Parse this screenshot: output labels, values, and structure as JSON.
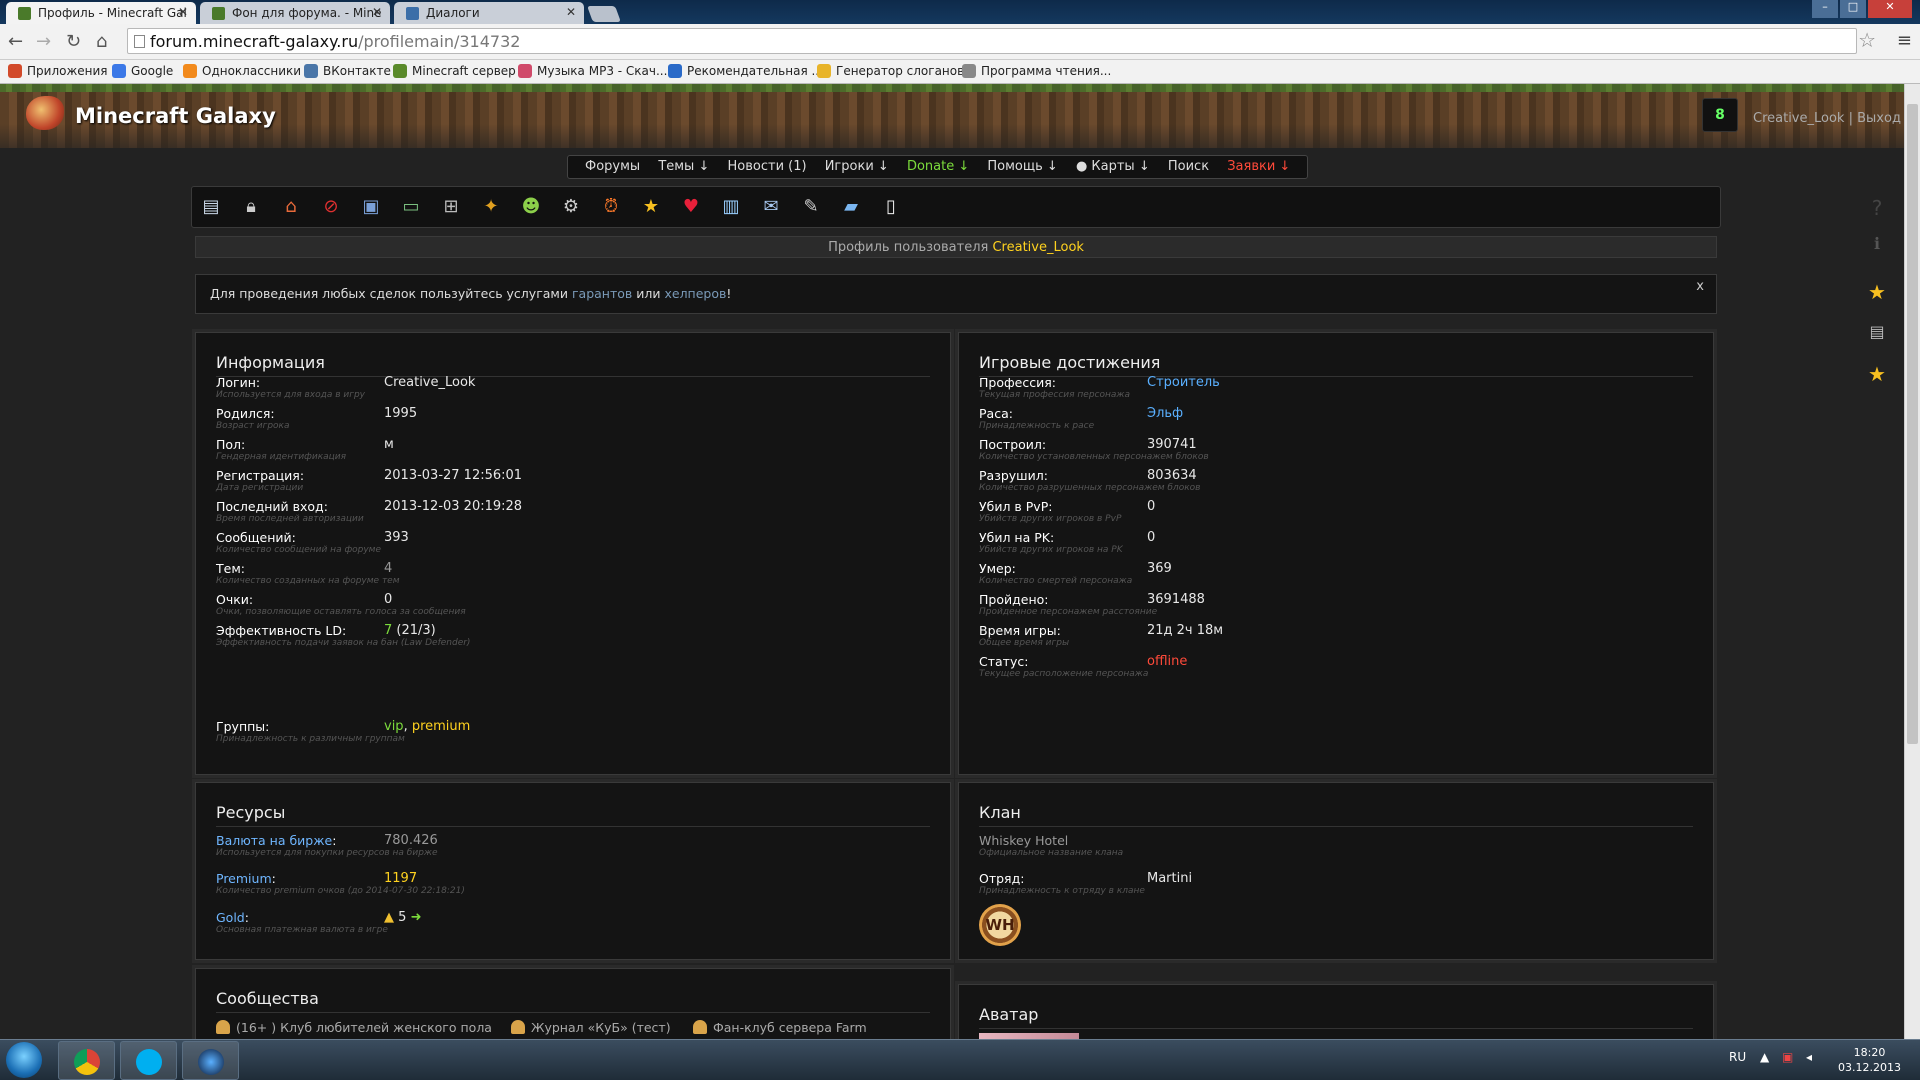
{
  "browser": {
    "tabs": [
      {
        "label": "Профиль - Minecraft Gal",
        "favcolor": "#4a7a2a"
      },
      {
        "label": "Фон для форума. - Mine",
        "favcolor": "#4a7a2a"
      },
      {
        "label": "Диалоги",
        "favcolor": "#3b6ea8"
      }
    ],
    "url_host": "forum.minecraft-galaxy.ru",
    "url_path": "/profilemain/314732",
    "bookmarks": [
      {
        "label": "Приложения",
        "color": "#d24a2a"
      },
      {
        "label": "Google",
        "color": "#3b78e7"
      },
      {
        "label": "Одноклассники",
        "color": "#f28a1c"
      },
      {
        "label": "ВКонтакте",
        "color": "#4a76a8"
      },
      {
        "label": "Minecraft сервер",
        "color": "#5a8a2a"
      },
      {
        "label": "Музыка MP3 - Скач...",
        "color": "#d04a6a"
      },
      {
        "label": "Рекомендательная ...",
        "color": "#2a6ac8"
      },
      {
        "label": "Генератор слоганов",
        "color": "#e8b42a"
      },
      {
        "label": "Программа чтения...",
        "color": "#888888"
      }
    ]
  },
  "site": {
    "title": "Minecraft Galaxy",
    "notif_count": "8",
    "username": "Creative_Look",
    "logout": "Выход",
    "menu": [
      {
        "label": "Форумы",
        "color": "#dddddd"
      },
      {
        "label": "Темы ↓",
        "color": "#dddddd"
      },
      {
        "label": "Новости (1)",
        "color": "#dddddd"
      },
      {
        "label": "Игроки ↓",
        "color": "#dddddd"
      },
      {
        "label": "Donate ↓",
        "color": "#7cdc3c"
      },
      {
        "label": "Помощь ↓",
        "color": "#dddddd"
      },
      {
        "label": "● Карты ↓",
        "color": "#dddddd"
      },
      {
        "label": "Поиск",
        "color": "#dddddd"
      },
      {
        "label": "Заявки ↓",
        "color": "#ff4a3a"
      }
    ],
    "icons": [
      "profile-card-icon",
      "lock-icon",
      "home-icon",
      "ban-icon",
      "gallery-icon",
      "monitor-icon",
      "cart-icon",
      "medal-icon",
      "user-icon",
      "gear-icon",
      "alarm-icon",
      "star-icon",
      "heart-icon",
      "chart-icon",
      "mail-icon",
      "edit-icon",
      "folder-icon",
      "notepad-icon"
    ],
    "profile_bar_prefix": "Профиль пользователя",
    "profile_bar_name": "Creative_Look",
    "alert": {
      "text1": "Для проведения любых сделок пользуйтесь услугами",
      "link1": "гарантов",
      "text2": "или",
      "link2": "хелперов",
      "text3": "!",
      "close": "x"
    },
    "info": {
      "title": "Информация",
      "rows": [
        {
          "label": "Логин:",
          "sub": "Используется для входа в игру",
          "value": "Creative_Look",
          "cls": ""
        },
        {
          "label": "Родился:",
          "sub": "Возраст игрока",
          "value": "1995",
          "cls": ""
        },
        {
          "label": "Пол:",
          "sub": "Гендерная идентификация",
          "value": "м",
          "cls": ""
        },
        {
          "label": "Регистрация:",
          "sub": "Дата регистрации",
          "value": "2013-03-27 12:56:01",
          "cls": ""
        },
        {
          "label": "Последний вход:",
          "sub": "Время последней авторизации",
          "value": "2013-12-03 20:19:28",
          "cls": ""
        },
        {
          "label": "Сообщений:",
          "sub": "Количество сообщений на форуме",
          "value": "393",
          "cls": ""
        },
        {
          "label": "Тем:",
          "sub": "Количество созданных на форуме тем",
          "value": "4",
          "cls": "gray"
        },
        {
          "label": "Очки:",
          "sub": "Очки, позволяющие оставлять голоса за сообщения",
          "value": "0",
          "cls": ""
        },
        {
          "label": "Эффективность LD:",
          "sub": "Эффективность подачи заявок на бан (Law Defender)",
          "value": "7",
          "value_extra": " (21/3)",
          "cls": "green"
        }
      ],
      "groups_label": "Группы:",
      "groups_sub": "Принадлежность к различным группам",
      "group1": "vip",
      "group_sep": ", ",
      "group2": "premium"
    },
    "achievements": {
      "title": "Игровые достижения",
      "rows": [
        {
          "label": "Профессия:",
          "sub": "Текущая профессия персонажа",
          "value": "Строитель",
          "cls": "blue"
        },
        {
          "label": "Раса:",
          "sub": "Принадлежность к расе",
          "value": "Эльф",
          "cls": "blue"
        },
        {
          "label": "Построил:",
          "sub": "Количество установленных персонажем блоков",
          "value": "390741",
          "cls": ""
        },
        {
          "label": "Разрушил:",
          "sub": "Количество разрушенных персонажем блоков",
          "value": "803634",
          "cls": ""
        },
        {
          "label": "Убил в PvP:",
          "sub": "Убийств других игроков в PvP",
          "value": "0",
          "cls": ""
        },
        {
          "label": "Убил на PK:",
          "sub": "Убийств других игроков на PK",
          "value": "0",
          "cls": ""
        },
        {
          "label": "Умер:",
          "sub": "Количество смертей персонажа",
          "value": "369",
          "cls": ""
        },
        {
          "label": "Пройдено:",
          "sub": "Пройденное персонажем расстояние",
          "value": "3691488",
          "cls": ""
        },
        {
          "label": "Время игры:",
          "sub": "Общее время игры",
          "value": "21д 2ч 18м",
          "cls": ""
        },
        {
          "label": "Статус:",
          "sub": "Текущее расположение персонажа",
          "value": "offline",
          "cls": "red"
        }
      ]
    },
    "resources": {
      "title": "Ресурсы",
      "rows": [
        {
          "label": "Валюта на бирже",
          "sub": "Используется для покупки ресурсов на бирже",
          "value": "780.426",
          "cls": "gray"
        },
        {
          "label": "Premium",
          "sub": "Количество premium очков (до 2014-07-30 22:18:21)",
          "value": "1197",
          "cls": "yellow"
        },
        {
          "label": "Gold",
          "sub": "Основная платежная валюта в игре",
          "value": "5",
          "cls": ""
        }
      ],
      "colon": ":"
    },
    "clan": {
      "title": "Клан",
      "name": "Whiskey Hotel",
      "name_sub": "Официальное название клана",
      "squad_label": "Отряд:",
      "squad_sub": "Принадлежность к отряду в клане",
      "squad": "Martini",
      "logo_text": "WH"
    },
    "communities": {
      "title": "Сообщества",
      "items": [
        "(16+ ) Клуб любителей женского пола",
        "Журнал «КуБ» (тест)",
        "Фан-клуб сервера Farm"
      ]
    },
    "avatar": {
      "title": "Аватар"
    }
  },
  "taskbar": {
    "lang": "RU",
    "time": "18:20",
    "date": "03.12.2013"
  }
}
